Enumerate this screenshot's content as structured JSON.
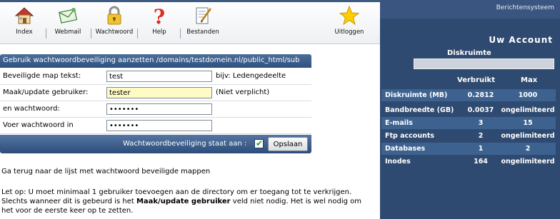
{
  "toolbar": {
    "items": [
      {
        "label": "Index",
        "icon": "house-icon"
      },
      {
        "label": "Webmail",
        "icon": "envelope-icon"
      },
      {
        "label": "Wachtwoord",
        "icon": "padlock-icon"
      },
      {
        "label": "Help",
        "icon": "question-mark-icon"
      },
      {
        "label": "Bestanden",
        "icon": "document-edit-icon"
      }
    ],
    "logout": {
      "label": "Uitloggen",
      "icon": "star-icon"
    }
  },
  "form": {
    "header": "Gebruik wachtwoordbeveiliging aanzetten /domains/testdomein.nl/public_html/sub",
    "rows": [
      {
        "label": "Beveiligde map tekst:",
        "value": "test",
        "note": "bijv: Ledengedeelte"
      },
      {
        "label": "Maak/update gebruiker:",
        "value": "tester",
        "note": "(Niet verplicht)"
      },
      {
        "label": "en wachtwoord:",
        "value": "•••••••",
        "note": ""
      },
      {
        "label": "Voer wachtwoord in",
        "value": "•••••••",
        "note": ""
      }
    ],
    "protection_label": "Wachtwoordbeveiliging staat aan :",
    "protection_checked": true,
    "save_label": "Opslaan"
  },
  "back_link": "Ga terug naar de lijst met wachtwoord beveiligde mappen",
  "note": {
    "line1": "Let op: U moet minimaal 1 gebruiker toevoegen aan de directory om er toegang tot te verkrijgen.",
    "line2_pre": "Slechts wanneer dit is gebeurd is het ",
    "line2_bold": "Maak/update gebruiker",
    "line2_post": " veld niet nodig. Het is wel nodig om",
    "line3": "het voor de eerste keer op te zetten."
  },
  "account": {
    "header_link": "Berichtensysteem",
    "title": "Uw Account",
    "disk_title": "Diskruimte",
    "disk_usage_fraction": 0.00028,
    "col_used": "Verbruikt",
    "col_max": "Max",
    "stats": [
      {
        "name": "Diskruimte (MB)",
        "used": "0.2812",
        "max": "1000"
      },
      {
        "name": "Bandbreedte (GB)",
        "used": "0.0037",
        "max": "ongelimiteerd"
      },
      {
        "name": "E-mails",
        "used": "3",
        "max": "15"
      },
      {
        "name": "Ftp accounts",
        "used": "2",
        "max": "ongelimiteerd"
      },
      {
        "name": "Databases",
        "used": "1",
        "max": "2"
      },
      {
        "name": "Inodes",
        "used": "164",
        "max": "ongelimiteerd"
      }
    ]
  },
  "colors": {
    "panel_bg": "#2f4a70",
    "panel_row_alt": "#3d6290",
    "form_header": "#3d5f8c",
    "highlight_input": "#fffbc4"
  }
}
